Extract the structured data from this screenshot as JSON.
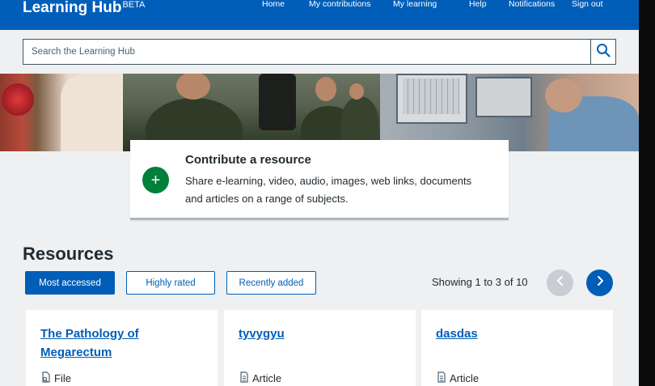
{
  "header": {
    "brand": "Learning Hub",
    "brand_tag": "BETA",
    "nav": [
      "Home",
      "My contributions",
      "My learning",
      "Help",
      "Notifications",
      "Sign out"
    ]
  },
  "search": {
    "placeholder": "Search the Learning Hub",
    "icon": "search-icon"
  },
  "contribute": {
    "icon": "plus-icon",
    "title": "Contribute a resource",
    "description": "Share e-learning, video, audio, images, web links, documents and articles on a range of subjects."
  },
  "resources": {
    "heading": "Resources",
    "tabs": [
      "Most accessed",
      "Highly rated",
      "Recently added"
    ],
    "active_tab": "Most accessed",
    "showing_text": "Showing 1 to 3 of 10",
    "prev_icon": "chevron-left-icon",
    "next_icon": "chevron-right-icon",
    "cards": [
      {
        "title": "The Pathology of Megarectum",
        "type": "File",
        "type_icon": "file-icon"
      },
      {
        "title": "tyvygyu",
        "type": "Article",
        "type_icon": "article-icon"
      },
      {
        "title": "dasdas",
        "type": "Article",
        "type_icon": "article-icon"
      }
    ]
  },
  "colors": {
    "primary": "#005eb8",
    "success": "#007f3b",
    "text": "#212b32",
    "background": "#eef0f2"
  }
}
